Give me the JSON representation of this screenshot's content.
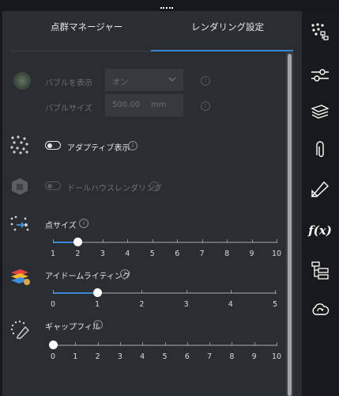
{
  "tabs": [
    {
      "label": "点群マネージャー",
      "active": false
    },
    {
      "label": "レンダリング設定",
      "active": true
    }
  ],
  "bubble": {
    "show_label": "バブルを表示",
    "show_value": "オン",
    "size_label": "バブルサイズ",
    "size_value": "500.00",
    "size_unit": "mm"
  },
  "adaptive": {
    "label": "アダプティブ表示",
    "enabled": false
  },
  "dollhouse": {
    "label": "ドールハウスレンダリング",
    "enabled": false
  },
  "point_size": {
    "label": "点サイズ",
    "value": 2,
    "ticks": [
      "1",
      "2",
      "3",
      "4",
      "5",
      "6",
      "7",
      "8",
      "9",
      "10"
    ]
  },
  "eye_dome": {
    "label": "アイドームライティング",
    "value": 1,
    "ticks": [
      "0",
      "1",
      "2",
      "3",
      "4",
      "5"
    ]
  },
  "gap_fill": {
    "label": "ギャップフィル",
    "value": 0,
    "ticks": [
      "0",
      "1",
      "2",
      "3",
      "4",
      "5",
      "6",
      "7",
      "8",
      "9",
      "10"
    ]
  },
  "sidebar_icons": [
    "point-cloud-icon",
    "sliders-icon",
    "layers-icon",
    "paperclip-icon",
    "measure-icon",
    "function-icon",
    "hierarchy-icon",
    "cloud-sync-icon"
  ],
  "sidebar_function_text": "f(x)",
  "colors": {
    "accent": "#3d86d6",
    "panel": "#2a2d32",
    "sidebar": "#17191c"
  }
}
